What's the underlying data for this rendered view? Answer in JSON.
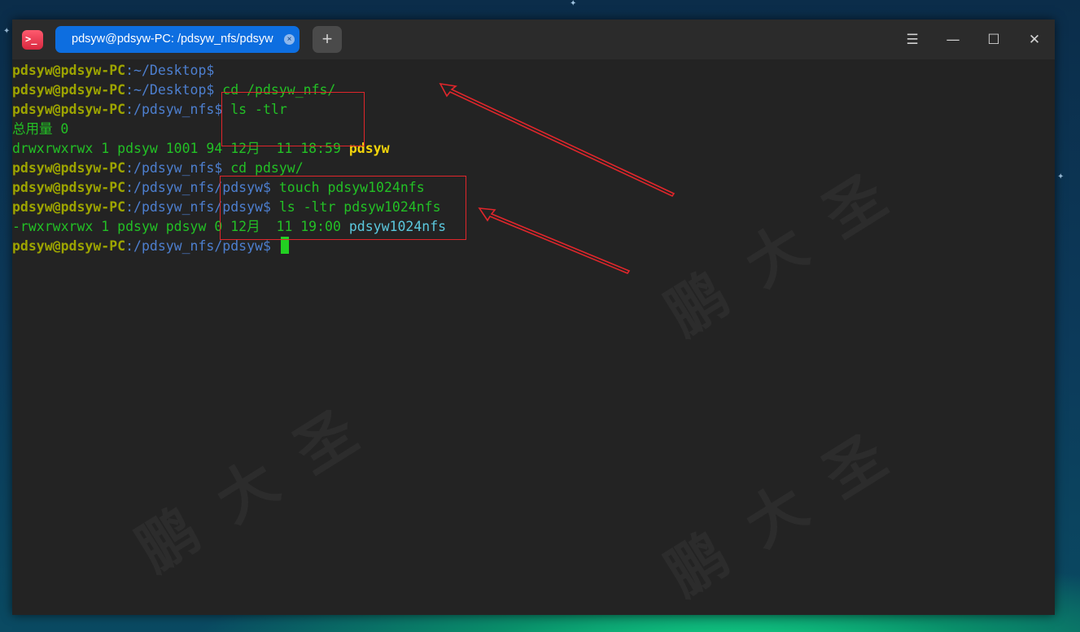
{
  "titlebar": {
    "tab_label": "pdsyw@pdsyw-PC: /pdsyw_nfs/pdsyw",
    "tab_close_glyph": "×",
    "new_tab_glyph": "+",
    "menu_glyph": "☰",
    "minimize_glyph": "—",
    "maximize_glyph": "☐",
    "close_glyph": "✕"
  },
  "watermark": {
    "text": "鹏大圣"
  },
  "terminal": {
    "lines": [
      {
        "user": "pdsyw@pdsyw-PC",
        "path": ":~/Desktop",
        "sep": "$",
        "cmd": ""
      },
      {
        "user": "pdsyw@pdsyw-PC",
        "path": ":~/Desktop",
        "sep": "$",
        "cmd": " cd /pdsyw_nfs/"
      },
      {
        "user": "pdsyw@pdsyw-PC",
        "path": ":/pdsyw_nfs",
        "sep": "$",
        "cmd": " ls -tlr"
      },
      {
        "text": "总用量 0"
      },
      {
        "text": "drwxrwxrwx 1 pdsyw 1001 94 12月  11 18:59 ",
        "name": "pdsyw"
      },
      {
        "user": "pdsyw@pdsyw-PC",
        "path": ":/pdsyw_nfs",
        "sep": "$",
        "cmd": " cd pdsyw/"
      },
      {
        "user": "pdsyw@pdsyw-PC",
        "path": ":/pdsyw_nfs/pdsyw",
        "sep": "$",
        "cmd": " touch pdsyw1024nfs"
      },
      {
        "user": "pdsyw@pdsyw-PC",
        "path": ":/pdsyw_nfs/pdsyw",
        "sep": "$",
        "cmd": " ls -ltr pdsyw1024nfs"
      },
      {
        "text": "-rwxrwxrwx 1 pdsyw pdsyw 0 12月  11 19:00 ",
        "name": "pdsyw1024nfs"
      },
      {
        "user": "pdsyw@pdsyw-PC",
        "path": ":/pdsyw_nfs/pdsyw",
        "sep": "$",
        "cmd": " "
      }
    ]
  },
  "colors": {
    "user": "#9da400",
    "path": "#4d7fcf",
    "command": "#23c025",
    "directory": "#f2d40a",
    "file": "#5bc8de",
    "annotation": "#e0262b",
    "tab_active": "#0d6ee0"
  },
  "icons": {
    "app": "terminal-icon",
    "tab_close": "close-icon",
    "new_tab": "plus-icon",
    "menu": "menu-icon",
    "minimize": "minimize-icon",
    "maximize": "maximize-icon",
    "close": "close-icon"
  }
}
